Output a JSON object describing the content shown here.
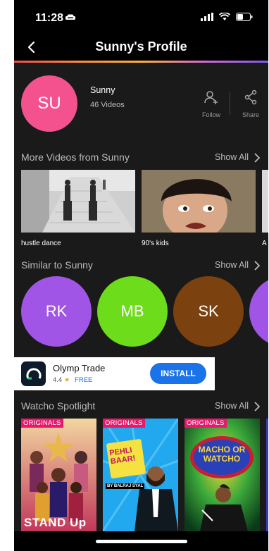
{
  "status_bar": {
    "time": "11:28"
  },
  "app_bar": {
    "title": "Sunny's Profile"
  },
  "profile": {
    "initials": "SU",
    "name": "Sunny",
    "videos": "46 Videos",
    "follow_label": "Follow",
    "share_label": "Share",
    "avatar_color": "#f4528f"
  },
  "more_videos": {
    "title": "More Videos from Sunny",
    "show_all": "Show All",
    "items": [
      {
        "label": "hustle dance"
      },
      {
        "label": "90's kids"
      },
      {
        "label": "A"
      }
    ]
  },
  "similar": {
    "title": "Similar to Sunny",
    "show_all": "Show All",
    "items": [
      {
        "initials": "RK",
        "color": "#a055e6"
      },
      {
        "initials": "MB",
        "color": "#6ddc1a"
      },
      {
        "initials": "SK",
        "color": "#7b4210"
      },
      {
        "initials": "",
        "color": "#a055e6"
      }
    ]
  },
  "ad": {
    "app_name": "Olymp Trade",
    "rating": "4.4",
    "price": "FREE",
    "install_label": "INSTALL"
  },
  "spotlight": {
    "title": "Watcho Spotlight",
    "show_all": "Show All",
    "items": [
      {
        "badge": "ORIGINALS",
        "title_art": "STAND Up"
      },
      {
        "badge": "ORIGINALS",
        "title_art": "PEHLI BAAR!",
        "byline": "BY BALRAJ SYAL"
      },
      {
        "badge": "ORIGINALS",
        "title_art": "MACHO OR WATCHO"
      }
    ]
  },
  "colors": {
    "accent": "#e6196d",
    "install": "#1a73e8",
    "background": "#1a1a1a"
  }
}
